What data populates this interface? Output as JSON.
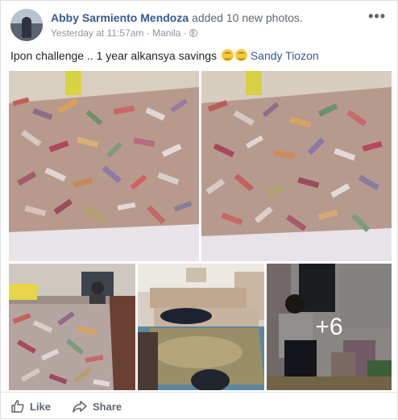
{
  "post": {
    "author": "Abby Sarmiento Mendoza",
    "action": "added 10 new photos.",
    "timestamp": "Yesterday at 11:57am",
    "location": "Manila",
    "separator": "·",
    "text": "Ipon challenge .. 1 year alkansya savings",
    "tagged": "Sandy Tiozon"
  },
  "photos": {
    "more_count": "+6"
  },
  "actions": {
    "like": "Like",
    "share": "Share"
  },
  "colors": {
    "link": "#365899",
    "muted": "#90949c",
    "action": "#606770"
  },
  "icons": {
    "more": "more-options-icon",
    "globe": "globe-icon",
    "like": "thumbs-up-icon",
    "share": "share-arrow-icon"
  }
}
